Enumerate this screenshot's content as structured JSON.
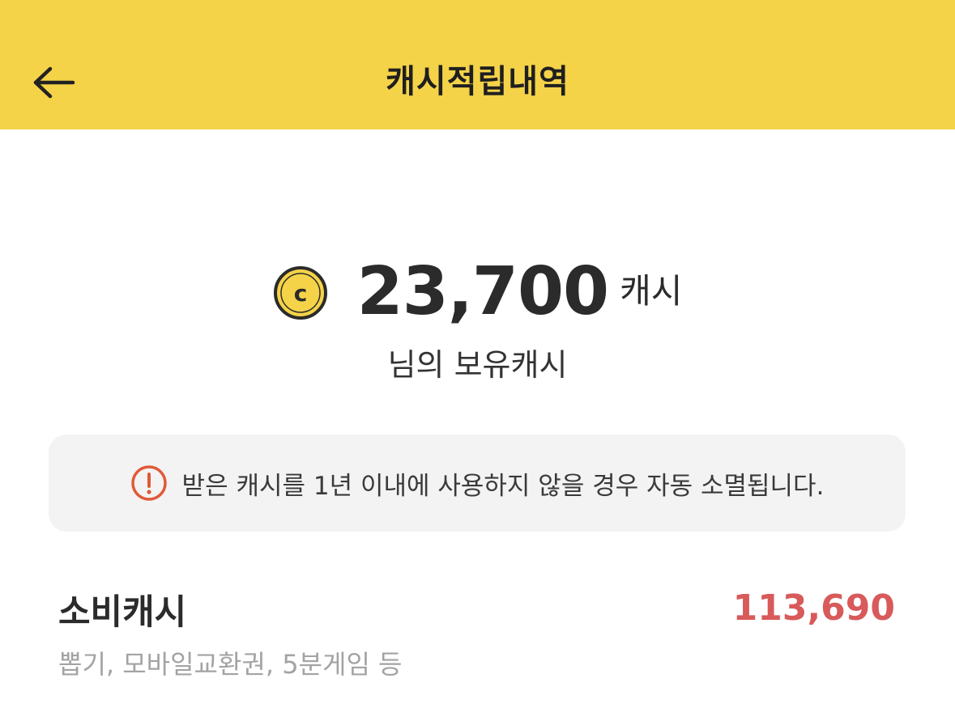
{
  "header": {
    "title": "캐시적립내역",
    "back_icon": "arrow-left-icon",
    "bg_color": "#f5d348"
  },
  "balance": {
    "coin_icon": "coin-c-icon",
    "amount": "23,700",
    "unit": "캐시",
    "owner_label": "님의 보유캐시"
  },
  "notice": {
    "icon": "exclamation-circle-icon",
    "icon_color": "#e05a38",
    "text": "받은 캐시를 1년 이내에 사용하지 않을 경우 자동 소멸됩니다."
  },
  "spend_cash": {
    "title": "소비캐시",
    "amount": "113,690",
    "amount_color": "#d85a5a",
    "description": "뽑기, 모바일교환권, 5분게임 등"
  }
}
